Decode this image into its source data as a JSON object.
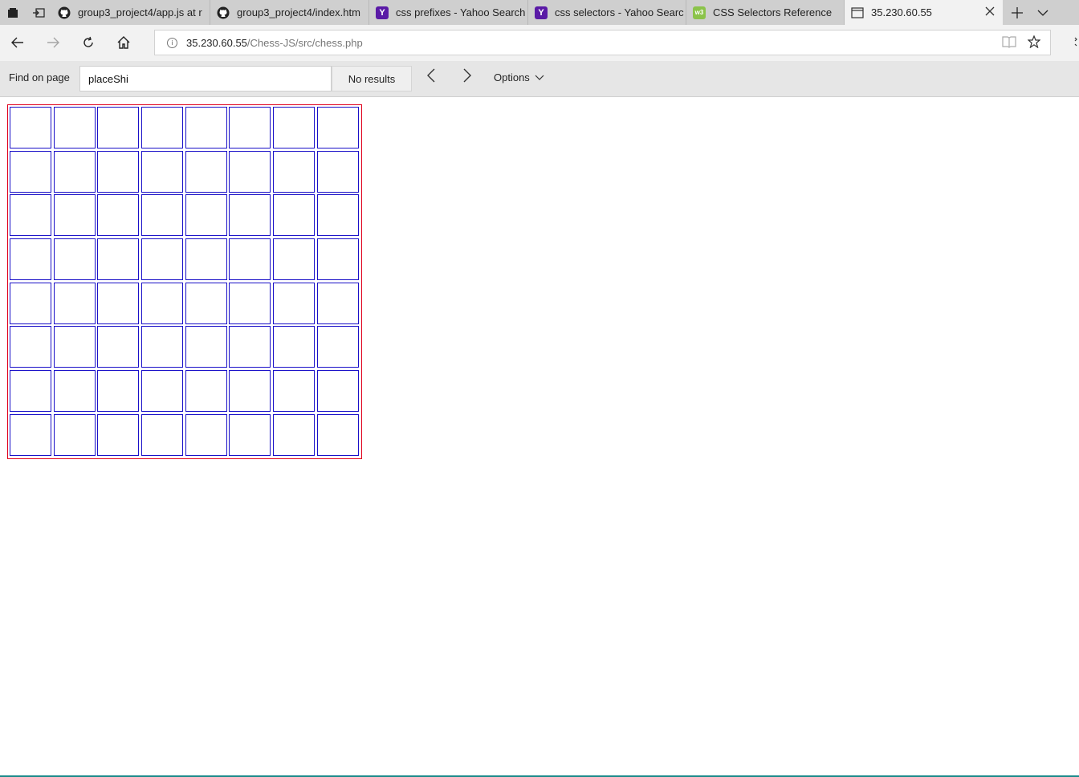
{
  "tabs": [
    {
      "title": "group3_project4/app.js at r",
      "icon": "github-icon"
    },
    {
      "title": "group3_project4/index.htm",
      "icon": "github-icon"
    },
    {
      "title": "css prefixes - Yahoo Search",
      "icon": "yahoo-icon"
    },
    {
      "title": "css selectors - Yahoo Searc",
      "icon": "yahoo-icon"
    },
    {
      "title": "CSS Selectors Reference",
      "icon": "w3schools-icon"
    },
    {
      "title": "35.230.60.55",
      "icon": "page-icon",
      "active": true
    }
  ],
  "address": {
    "host": "35.230.60.55",
    "path": "/Chess-JS/src/chess.php"
  },
  "find": {
    "label": "Find on page",
    "query": "placeShi",
    "results": "No results",
    "options_label": "Options"
  },
  "board": {
    "rows": 8,
    "cols": 8,
    "border_color": "#e0001c",
    "cell_border_color": "#1a10c8"
  }
}
